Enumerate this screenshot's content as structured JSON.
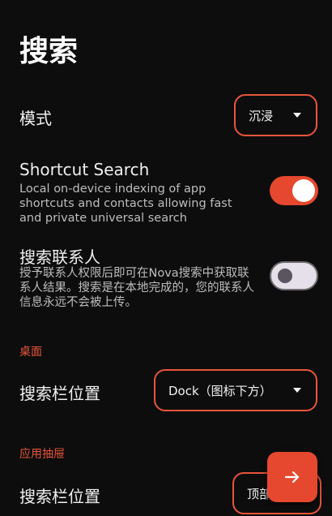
{
  "page": {
    "title": "搜索"
  },
  "mode": {
    "label": "模式",
    "value": "沉浸"
  },
  "shortcut_search": {
    "label": "Shortcut Search",
    "description": "Local on-device indexing of app shortcuts and contacts allowing fast and private universal search",
    "enabled": true
  },
  "contacts": {
    "label": "搜索联系人",
    "description": "授予联系人权限后即可在Nova搜索中获取联系人结果。搜索是在本地完成的，您的联系人信息永远不会被上传。",
    "enabled": false
  },
  "desktop": {
    "header": "桌面",
    "bar_position_label": "搜索栏位置",
    "bar_position_value": "Dock（图标下方）"
  },
  "drawer": {
    "header": "应用抽屉",
    "bar_position_label": "搜索栏位置",
    "bar_position_value": "顶部"
  },
  "colors": {
    "accent": "#e8553a",
    "background": "#0d0d0d"
  },
  "icons": {
    "fab": "arrow-right-icon",
    "dropdown": "caret-down-icon"
  }
}
